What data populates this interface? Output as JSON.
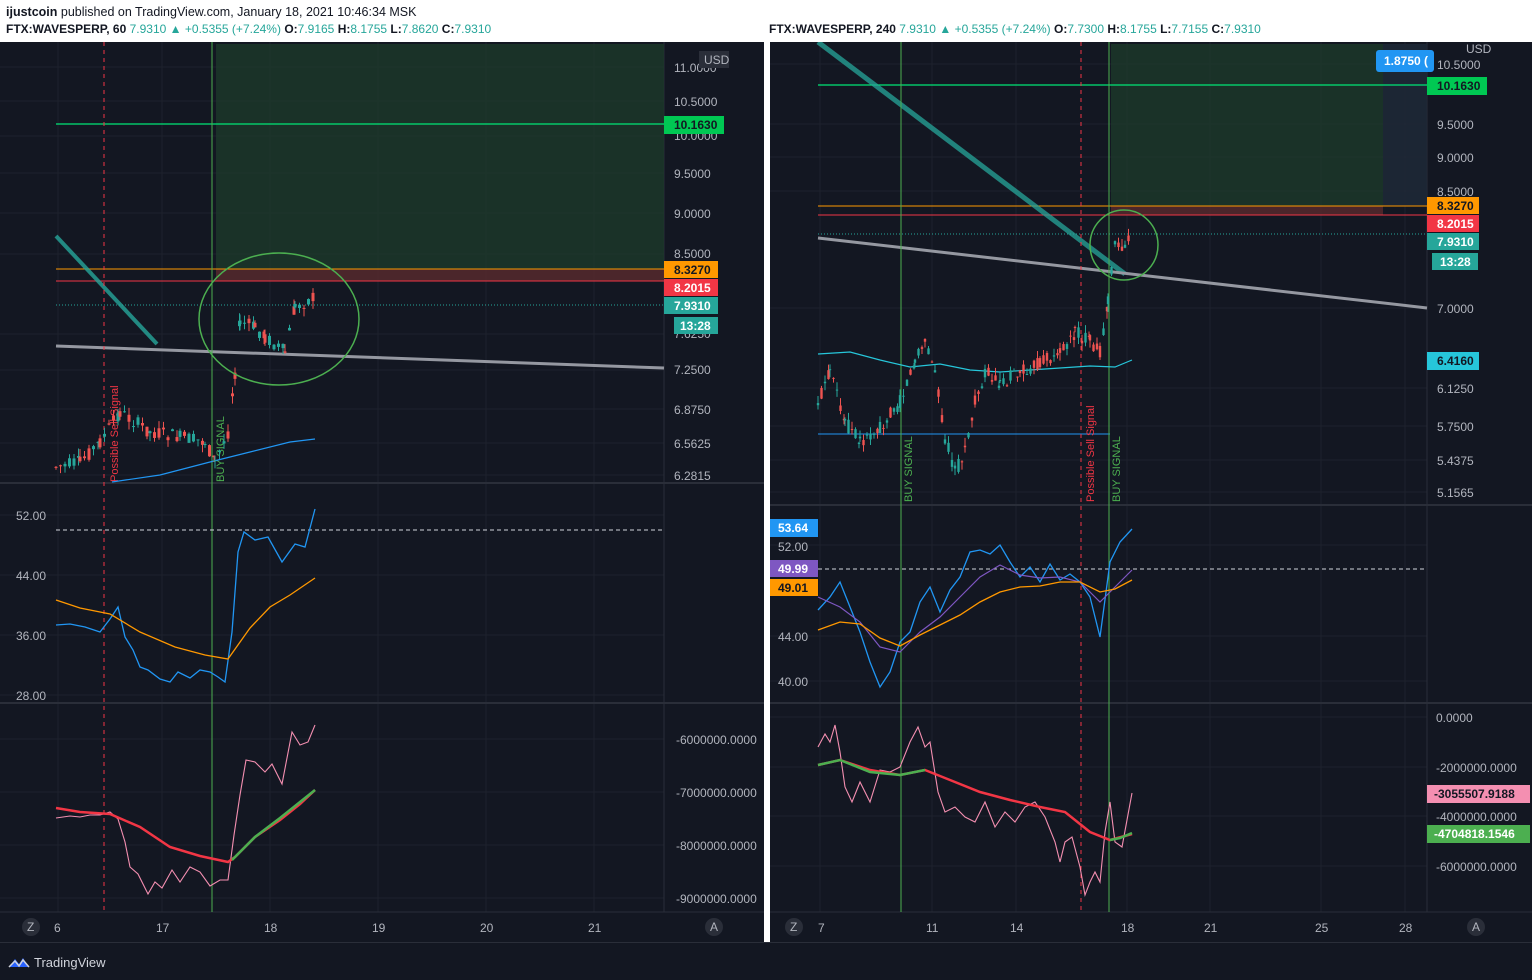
{
  "header": {
    "author": "ijustcoin",
    "published": "published on TradingView.com, January 18, 2021 10:46:34 MSK"
  },
  "left_chart": {
    "symbol": "FTX:WAVESPERP, 60",
    "last": "7.9310",
    "change": "+0.5355 (+7.24%)",
    "open_label": "O:",
    "open": "7.9165",
    "high_label": "H:",
    "high": "8.1755",
    "low_label": "L:",
    "low": "7.8620",
    "close_label": "C:",
    "close": "7.9310",
    "currency": "USD",
    "price_ticks": [
      "11.0000",
      "10.5000",
      "10.0000",
      "9.5000",
      "9.0000",
      "8.5000",
      "7.6250",
      "7.2500",
      "6.8750",
      "6.5625",
      "6.2815"
    ],
    "tags": {
      "tp": "10.1630",
      "orange": "8.3270",
      "red": "8.2015",
      "price": "7.9310",
      "timer": "13:28"
    },
    "signals": {
      "sell": "Possible Sell Signal",
      "buy": "BUY SIGNAL"
    },
    "osc_ticks": [
      "52.00",
      "44.00",
      "36.00",
      "28.00"
    ],
    "vol_ticks": [
      "-6000000.0000",
      "-7000000.0000",
      "-8000000.0000",
      "-9000000.0000"
    ],
    "time_ticks": [
      "6",
      "17",
      "18",
      "19",
      "20",
      "21"
    ]
  },
  "right_chart": {
    "symbol": "FTX:WAVESPERP, 240",
    "last": "7.9310",
    "change": "+0.5355 (+7.24%)",
    "open_label": "O:",
    "open": "7.7300",
    "high_label": "H:",
    "high": "8.1755",
    "low_label": "L:",
    "low": "7.7155",
    "close_label": "C:",
    "close": "7.9310",
    "currency": "USD",
    "price_ticks": [
      "10.5000",
      "9.5000",
      "9.0000",
      "8.5000",
      "7.0000",
      "6.1250",
      "5.7500",
      "5.4375",
      "5.1565"
    ],
    "tags": {
      "measure": "1.8750 (",
      "tp": "10.1630",
      "orange": "8.3270",
      "red": "8.2015",
      "price": "7.9310",
      "timer": "13:28",
      "ema": "6.4160"
    },
    "signals": {
      "buy1": "BUY SIGNAL",
      "sell": "Possible Sell Signal",
      "buy2": "BUY SIGNAL"
    },
    "osc_ticks": [
      "52.00",
      "44.00",
      "40.00"
    ],
    "osc_tags": {
      "blue": "53.64",
      "purple": "49.99",
      "orange": "49.01"
    },
    "vol_ticks": [
      "0.0000",
      "-2000000.0000",
      "-4000000.0000",
      "-6000000.0000"
    ],
    "vol_tags": {
      "pink": "-3055507.9188",
      "green": "-4704818.1546"
    },
    "time_ticks": [
      "7",
      "11",
      "14",
      "18",
      "21",
      "25",
      "28"
    ]
  },
  "footer": {
    "brand": "TradingView"
  },
  "colors": {
    "bg": "#131722",
    "grid": "#1e222d",
    "up": "#26a69a",
    "down": "#ef5350",
    "tp": "#00c853",
    "orange": "#ff9800",
    "red": "#f23645",
    "blue": "#2196f3",
    "purple": "#7e57c2",
    "pink": "#f48fb1"
  }
}
